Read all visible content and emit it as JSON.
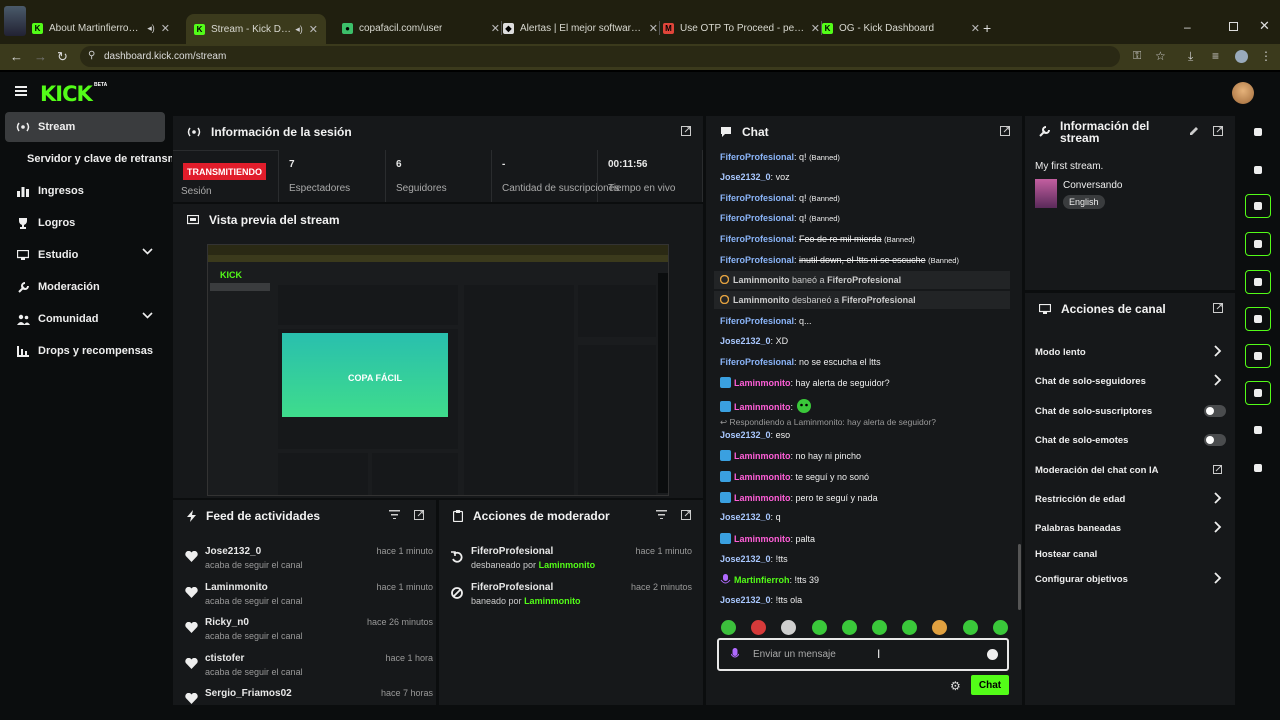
{
  "browser": {
    "tabs": [
      {
        "title": "About Martinfierroh - Watc",
        "fav_color": "#53fc18",
        "fav_glyph": "K"
      },
      {
        "title": "Stream - Kick Dashboard",
        "fav_color": "#53fc18",
        "fav_glyph": "K"
      },
      {
        "title": "copafacil.com/user",
        "fav_color": "#3cbf6a",
        "fav_glyph": "●"
      },
      {
        "title": "Alertas | El mejor software para",
        "fav_color": "#dddddd",
        "fav_glyph": "◆"
      },
      {
        "title": "Use OTP To Proceed - pelmasti",
        "fav_color": "#e0453a",
        "fav_glyph": "M"
      },
      {
        "title": "OG - Kick Dashboard",
        "fav_color": "#53fc18",
        "fav_glyph": "K"
      }
    ],
    "url": "dashboard.kick.com/stream"
  },
  "brand": {
    "logo": "KICK",
    "badge": "BETA",
    "accent": "#53fc18"
  },
  "sidebar": {
    "items": [
      {
        "label": "Stream",
        "icon": "broadcast-icon"
      },
      {
        "label": "Servidor y clave de retransmisión",
        "icon": ""
      },
      {
        "label": "Ingresos",
        "icon": "bar-chart-icon"
      },
      {
        "label": "Logros",
        "icon": "trophy-icon"
      },
      {
        "label": "Estudio",
        "icon": "monitor-icon"
      },
      {
        "label": "Moderación",
        "icon": "wrench-icon"
      },
      {
        "label": "Comunidad",
        "icon": "people-icon"
      },
      {
        "label": "Drops y recompensas",
        "icon": "gift-icon"
      }
    ]
  },
  "session": {
    "title": "Información de la sesión",
    "live_label": "TRANSMITIENDO",
    "session_label": "Sesión",
    "stats": [
      {
        "value": "7",
        "label": "Espectadores"
      },
      {
        "value": "6",
        "label": "Seguidores"
      },
      {
        "value": "-",
        "label": "Cantidad de suscripciones"
      },
      {
        "value": "00:11:56",
        "label": "Tiempo en vivo"
      }
    ]
  },
  "preview": {
    "title": "Vista previa del stream",
    "logo_text": "COPA FÁCIL"
  },
  "activity": {
    "title": "Feed de actividades",
    "items": [
      {
        "name": "Jose2132_0",
        "desc": "acaba de seguir el canal",
        "time": "hace 1 minuto"
      },
      {
        "name": "Laminmonito",
        "desc": "acaba de seguir el canal",
        "time": "hace 1 minuto"
      },
      {
        "name": "Ricky_n0",
        "desc": "acaba de seguir el canal",
        "time": "hace 26 minutos"
      },
      {
        "name": "ctistofer",
        "desc": "acaba de seguir el canal",
        "time": "hace 1 hora"
      },
      {
        "name": "Sergio_Friamos02",
        "desc": "",
        "time": "hace 7 horas"
      }
    ]
  },
  "mod_actions": {
    "title": "Acciones de moderador",
    "items": [
      {
        "name": "FiferoProfesional",
        "action": "desbaneado por",
        "by": "Laminmonito",
        "time": "hace 1 minuto",
        "icon": "undo-icon"
      },
      {
        "name": "FiferoProfesional",
        "action": "baneado por",
        "by": "Laminmonito",
        "time": "hace 2 minutos",
        "icon": "ban-icon"
      }
    ]
  },
  "chat": {
    "title": "Chat",
    "banned_tag": "(Banned)",
    "messages": [
      {
        "user": "FiferoProfesional",
        "text": "q!",
        "color": "#8ab4f8",
        "banned": true,
        "strike": false
      },
      {
        "user": "Jose2132_0",
        "text": "voz",
        "color": "#a9c8ff",
        "banned": false,
        "strike": false
      },
      {
        "user": "FiferoProfesional",
        "text": "q!",
        "color": "#8ab4f8",
        "banned": true,
        "strike": false
      },
      {
        "user": "FiferoProfesional",
        "text": "q!",
        "color": "#8ab4f8",
        "banned": true,
        "strike": false
      },
      {
        "user": "FiferoProfesional",
        "text": "Feo de re mil mierda",
        "color": "#8ab4f8",
        "banned": true,
        "strike": true
      },
      {
        "user": "FiferoProfesional",
        "text": "inutil down, el !tts ni se escuche",
        "color": "#8ab4f8",
        "banned": true,
        "strike": true
      },
      {
        "system": "baneó a",
        "actor": "Laminmonito",
        "target": "FiferoProfesional",
        "icon": "shield-icon"
      },
      {
        "system": "desbaneó a",
        "actor": "Laminmonito",
        "target": "FiferoProfesional",
        "icon": "undo-icon"
      },
      {
        "user": "FiferoProfesional",
        "text": "q...",
        "color": "#8ab4f8",
        "banned": false,
        "strike": false
      },
      {
        "user": "Jose2132_0",
        "text": "XD",
        "color": "#a9c8ff",
        "banned": false,
        "strike": false
      },
      {
        "user": "FiferoProfesional",
        "text": "no se escucha el ltts",
        "color": "#8ab4f8",
        "banned": false,
        "strike": false
      },
      {
        "user": "Laminmonito",
        "text": "hay alerta de seguidor?",
        "color": "#ff5fd8",
        "badge": "mod",
        "banned": false,
        "strike": false
      },
      {
        "user": "Laminmonito",
        "text": "",
        "color": "#ff5fd8",
        "badge": "mod",
        "emote": true,
        "banned": false,
        "strike": false
      },
      {
        "reply": "Respondiendo a Laminmonito: hay alerta de seguidor?"
      },
      {
        "user": "Jose2132_0",
        "text": "eso",
        "color": "#a9c8ff",
        "banned": false,
        "strike": false
      },
      {
        "user": "Laminmonito",
        "text": "no hay ni pincho",
        "color": "#ff5fd8",
        "badge": "mod",
        "banned": false,
        "strike": false
      },
      {
        "user": "Laminmonito",
        "text": "te seguí y no sonó",
        "color": "#ff5fd8",
        "badge": "mod",
        "banned": false,
        "strike": false
      },
      {
        "user": "Laminmonito",
        "text": "pero te seguí y nada",
        "color": "#ff5fd8",
        "badge": "mod",
        "banned": false,
        "strike": false
      },
      {
        "user": "Jose2132_0",
        "text": "q",
        "color": "#a9c8ff",
        "banned": false,
        "strike": false
      },
      {
        "user": "Laminmonito",
        "text": "palta",
        "color": "#ff5fd8",
        "badge": "mod",
        "banned": false,
        "strike": false
      },
      {
        "user": "Jose2132_0",
        "text": "!tts",
        "color": "#a9c8ff",
        "banned": false,
        "strike": false
      },
      {
        "user": "Martinfierroh",
        "text": "!tts 39",
        "color": "#53fc18",
        "badge": "host",
        "banned": false,
        "strike": false
      },
      {
        "user": "Jose2132_0",
        "text": "!tts ola",
        "color": "#a9c8ff",
        "banned": false,
        "strike": false
      }
    ],
    "input_placeholder": "Enviar un mensaje",
    "send_label": "Chat",
    "emote_colors": [
      "#3cbf3c",
      "#d63a3a",
      "#cfcfcf",
      "#3ac83a",
      "#3ac83a",
      "#3ac83a",
      "#3ac83a",
      "#e0a040",
      "#3ac83a",
      "#3ac83a"
    ]
  },
  "stream_info": {
    "title": "Información del stream",
    "stream_title": "My first stream.",
    "category": "Conversando",
    "language": "English"
  },
  "channel_actions": {
    "title": "Acciones de canal",
    "items": [
      {
        "label": "Modo lento",
        "control": "chevron"
      },
      {
        "label": "Chat de solo-seguidores",
        "control": "chevron"
      },
      {
        "label": "Chat de solo-suscriptores",
        "control": "toggle"
      },
      {
        "label": "Chat de solo-emotes",
        "control": "toggle"
      },
      {
        "label": "Moderación del chat con IA",
        "control": "external"
      },
      {
        "label": "Restricción de edad",
        "control": "chevron"
      },
      {
        "label": "Palabras baneadas",
        "control": "chevron"
      },
      {
        "label": "Hostear canal",
        "control": "none"
      },
      {
        "label": "Configurar objetivos",
        "control": "chevron"
      }
    ]
  }
}
